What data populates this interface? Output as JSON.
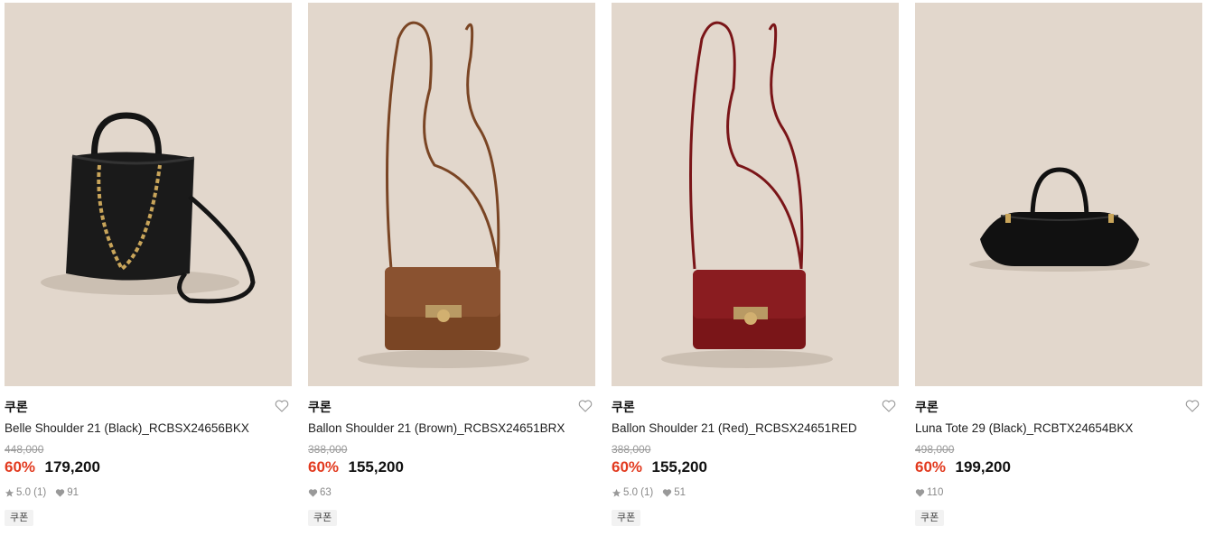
{
  "products": [
    {
      "brand": "쿠론",
      "name": "Belle Shoulder 21 (Black)_RCBSX24656BKX",
      "original_price": "448,000",
      "discount": "60%",
      "price": "179,200",
      "rating": "5.0 (1)",
      "likes": "91",
      "coupon": "쿠폰",
      "image_icon": "black-bucket-bag-image",
      "bag_color": "#1a1a1a"
    },
    {
      "brand": "쿠론",
      "name": "Ballon Shoulder 21 (Brown)_RCBSX24651BRX",
      "original_price": "388,000",
      "discount": "60%",
      "price": "155,200",
      "likes": "63",
      "coupon": "쿠폰",
      "image_icon": "brown-crossbody-bag-image",
      "bag_color": "#7a4524"
    },
    {
      "brand": "쿠론",
      "name": "Ballon Shoulder 21 (Red)_RCBSX24651RED",
      "original_price": "388,000",
      "discount": "60%",
      "price": "155,200",
      "rating": "5.0 (1)",
      "likes": "51",
      "coupon": "쿠폰",
      "image_icon": "red-crossbody-bag-image",
      "bag_color": "#7a1518"
    },
    {
      "brand": "쿠론",
      "name": "Luna Tote 29 (Black)_RCBTX24654BKX",
      "original_price": "498,000",
      "discount": "60%",
      "price": "199,200",
      "likes": "110",
      "coupon": "쿠폰",
      "image_icon": "black-tote-bag-image",
      "bag_color": "#111111"
    }
  ],
  "colors": {
    "thumb_bg": "#e2d7cc",
    "discount": "#e23a1f"
  }
}
